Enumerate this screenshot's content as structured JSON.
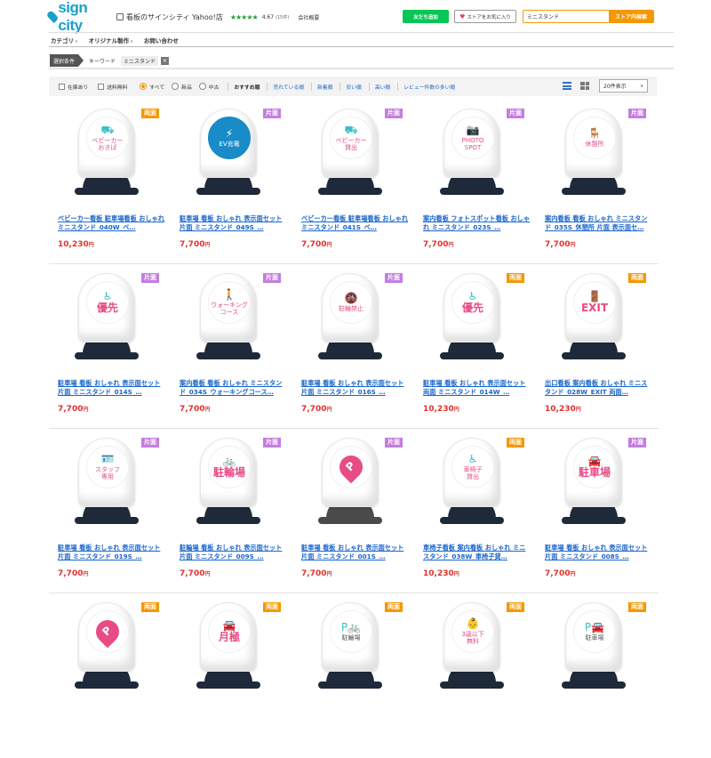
{
  "header": {
    "logo_text": "sign city",
    "store_name": "看板のサインシティ Yahoo!店",
    "stars": "★★★★★",
    "rating": "4.67",
    "review_count": "(15件)",
    "company_link": "会社概要",
    "line_button": "友だち追加",
    "favorite_button": "ストアをお気に入り",
    "search_value": "ミニスタンド",
    "search_button": "ストア内検索"
  },
  "nav": {
    "items": [
      "カテゴリ",
      "オリジナル製作",
      "お問い合わせ"
    ]
  },
  "filter": {
    "condition_label": "選択条件",
    "keyword_label": "キーワード",
    "keyword_value": "ミニスタンド",
    "clear": "✕"
  },
  "sortbar": {
    "in_stock": "在庫あり",
    "free_shipping": "送料無料",
    "condition_all": "すべて",
    "condition_new": "新品",
    "condition_used": "中古",
    "sort_label": "おすすめ順",
    "sort_options": [
      "売れている順",
      "新着順",
      "安い順",
      "高い順",
      "レビュー件数の多い順"
    ],
    "per_page": "20件表示"
  },
  "colors": {
    "accent": "#f39800",
    "link": "#1a66cc",
    "price": "#e0322d",
    "line_green": "#06c755",
    "badge_double": "#f39800",
    "badge_single": "#c47de0",
    "teal": "#3bbfc4",
    "pink": "#e84b85"
  },
  "products": [
    {
      "badge": "両面",
      "badge_type": "double",
      "icon": "baby-stroller-icon",
      "icon_glyph": "⛟",
      "text": "ベビーカー\nおきば",
      "color": "#e84b85",
      "title": "ベビーカー看板 駐車場看板 おしゃれ ミニスタンド_040W_ベ…",
      "price": "10,230",
      "yen": "円"
    },
    {
      "badge": "片面",
      "badge_type": "single",
      "icon": "ev-charger-icon",
      "icon_glyph": "⚡",
      "text": "EV充電",
      "color": "#ffffff",
      "filled": true,
      "title": "駐車場 看板 おしゃれ 表示面セット 片面 ミニスタンド_049S_…",
      "price": "7,700",
      "yen": "円"
    },
    {
      "badge": "片面",
      "badge_type": "single",
      "icon": "baby-stroller-icon",
      "icon_glyph": "⛟",
      "text": "ベビーカー\n貸出",
      "color": "#e84b85",
      "title": "ベビーカー看板 駐車場看板 おしゃれ ミニスタンド_041S_ベ…",
      "price": "7,700",
      "yen": "円"
    },
    {
      "badge": "片面",
      "badge_type": "single",
      "icon": "camera-icon",
      "icon_glyph": "📷",
      "text": "PHOTO\nSPOT",
      "color": "#e84b85",
      "title": "案内看板 フォトスポット看板 おしゃれ ミニスタンド_023S_…",
      "price": "7,700",
      "yen": "円"
    },
    {
      "badge": "片面",
      "badge_type": "single",
      "icon": "rest-area-icon",
      "icon_glyph": "🪑",
      "text": "休憩所",
      "color": "#e84b85",
      "title": "案内看板 看板 おしゃれ ミニスタンド_035S_休憩所 片面 表示面セ…",
      "price": "7,700",
      "yen": "円"
    },
    {
      "badge": "片面",
      "badge_type": "single",
      "icon": "wheelchair-icon",
      "icon_glyph": "♿",
      "text": "優先",
      "big": true,
      "color": "#e84b85",
      "title": "駐車場 看板 おしゃれ 表示面セット 片面 ミニスタンド_014S_…",
      "price": "7,700",
      "yen": "円"
    },
    {
      "badge": "片面",
      "badge_type": "single",
      "icon": "walking-icon",
      "icon_glyph": "🚶",
      "text": "ウォーキング\nコース",
      "color": "#e84b85",
      "title": "案内看板 看板 おしゃれ ミニスタンド_034S_ウォーキングコース…",
      "price": "7,700",
      "yen": "円"
    },
    {
      "badge": "片面",
      "badge_type": "single",
      "icon": "no-bicycle-icon",
      "icon_glyph": "🚳",
      "text": "駐輪禁止",
      "color": "#e84b85",
      "title": "駐車場 看板 おしゃれ 表示面セット 片面 ミニスタンド_016S_…",
      "price": "7,700",
      "yen": "円"
    },
    {
      "badge": "両面",
      "badge_type": "double",
      "icon": "wheelchair-icon",
      "icon_glyph": "♿",
      "text": "優先",
      "big": true,
      "color": "#e84b85",
      "title": "駐車場 看板 おしゃれ 表示面セット 両面 ミニスタンド_014W_…",
      "price": "10,230",
      "yen": "円"
    },
    {
      "badge": "両面",
      "badge_type": "double",
      "icon": "exit-icon",
      "icon_glyph": "🚪",
      "text": "EXIT",
      "big": true,
      "color": "#e84b85",
      "title": "出口看板 案内看板 おしゃれ ミニスタンド_028W_EXIT 両面…",
      "price": "10,230",
      "yen": "円"
    },
    {
      "badge": "片面",
      "badge_type": "single",
      "icon": "staff-icon",
      "icon_glyph": "🪪",
      "text": "スタッフ\n専用",
      "color": "#e84b85",
      "title": "駐車場 看板 おしゃれ 表示面セット 片面 ミニスタンド_019S_…",
      "price": "7,700",
      "yen": "円"
    },
    {
      "badge": "片面",
      "badge_type": "single",
      "icon": "bicycle-icon",
      "icon_glyph": "🚲",
      "text": "駐輪場",
      "big": true,
      "color": "#e84b85",
      "title": "駐輪場 看板 おしゃれ 表示面セット 片面 ミニスタンド_009S_…",
      "price": "7,700",
      "yen": "円"
    },
    {
      "badge": "片面",
      "badge_type": "single",
      "icon": "parking-pin-icon",
      "icon_glyph": "P",
      "text": "",
      "color": "#e84b85",
      "pin": true,
      "grey_base": true,
      "title": "駐車場 看板 おしゃれ 表示面セット 片面 ミニスタンド_001S_…",
      "price": "7,700",
      "yen": "円"
    },
    {
      "badge": "両面",
      "badge_type": "double",
      "icon": "wheelchair-icon",
      "icon_glyph": "♿",
      "text": "車椅子\n貸出",
      "color": "#e84b85",
      "title": "車椅子看板 案内看板 おしゃれ ミニスタンド_038W_車椅子貸…",
      "price": "10,230",
      "yen": "円"
    },
    {
      "badge": "片面",
      "badge_type": "single",
      "icon": "car-icon",
      "icon_glyph": "🚘",
      "text": "駐車場",
      "big": true,
      "color": "#e84b85",
      "title": "駐車場 看板 おしゃれ 表示面セット 片面 ミニスタンド_008S_…",
      "price": "7,700",
      "yen": "円"
    },
    {
      "badge": "両面",
      "badge_type": "double",
      "icon": "parking-pin-icon",
      "icon_glyph": "P",
      "text": "",
      "color": "#e84b85",
      "pin": true,
      "title": "",
      "price": "",
      "yen": ""
    },
    {
      "badge": "両面",
      "badge_type": "double",
      "icon": "car-icon",
      "icon_glyph": "🚘",
      "text": "月極",
      "big": true,
      "color": "#e84b85",
      "title": "",
      "price": "",
      "yen": ""
    },
    {
      "badge": "両面",
      "badge_type": "double",
      "icon": "bicycle-parking-icon",
      "icon_glyph": "P🚲",
      "text": "駐輪場",
      "color": "#555555",
      "title": "",
      "price": "",
      "yen": ""
    },
    {
      "badge": "両面",
      "badge_type": "double",
      "icon": "child-icon",
      "icon_glyph": "👶",
      "text": "3歳以下\n無料",
      "color": "#e84b85",
      "title": "",
      "price": "",
      "yen": ""
    },
    {
      "badge": "両面",
      "badge_type": "double",
      "icon": "car-parking-icon",
      "icon_glyph": "P🚘",
      "text": "駐車場",
      "color": "#555555",
      "title": "",
      "price": "",
      "yen": ""
    }
  ]
}
